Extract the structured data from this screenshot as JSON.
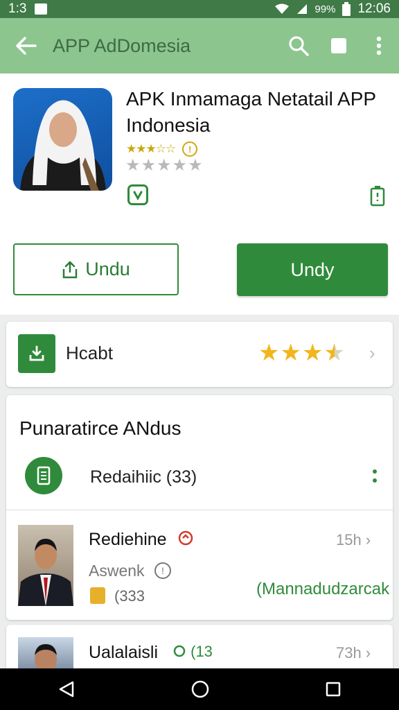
{
  "status_bar": {
    "time_left": "1:3",
    "battery": "99%",
    "time_right": "12:06"
  },
  "app_bar": {
    "title": "APP AdDomesia"
  },
  "app": {
    "title": "APK Inmamaga Netatail APP Indonesia",
    "star_text": "★★★☆☆",
    "info_mark": "!"
  },
  "buttons": {
    "outline_label": "Undu",
    "filled_label": "Undy"
  },
  "rating_card": {
    "label": "Hcabt",
    "rating": 3.5
  },
  "section": {
    "title": "Punaratirce ANdus",
    "subheader": "Redaihiic (33)"
  },
  "reviews": [
    {
      "name": "Rediehine",
      "time": "15h",
      "subtitle": "Aswenk",
      "count": "(333",
      "note": "(Mannadudzarcak"
    },
    {
      "name": "Ualalaisli",
      "tag": "(13",
      "time": "73h"
    }
  ],
  "colors": {
    "accent": "#2f8b3b",
    "appbar": "#8cc58e",
    "statusbar": "#3f7a47"
  }
}
